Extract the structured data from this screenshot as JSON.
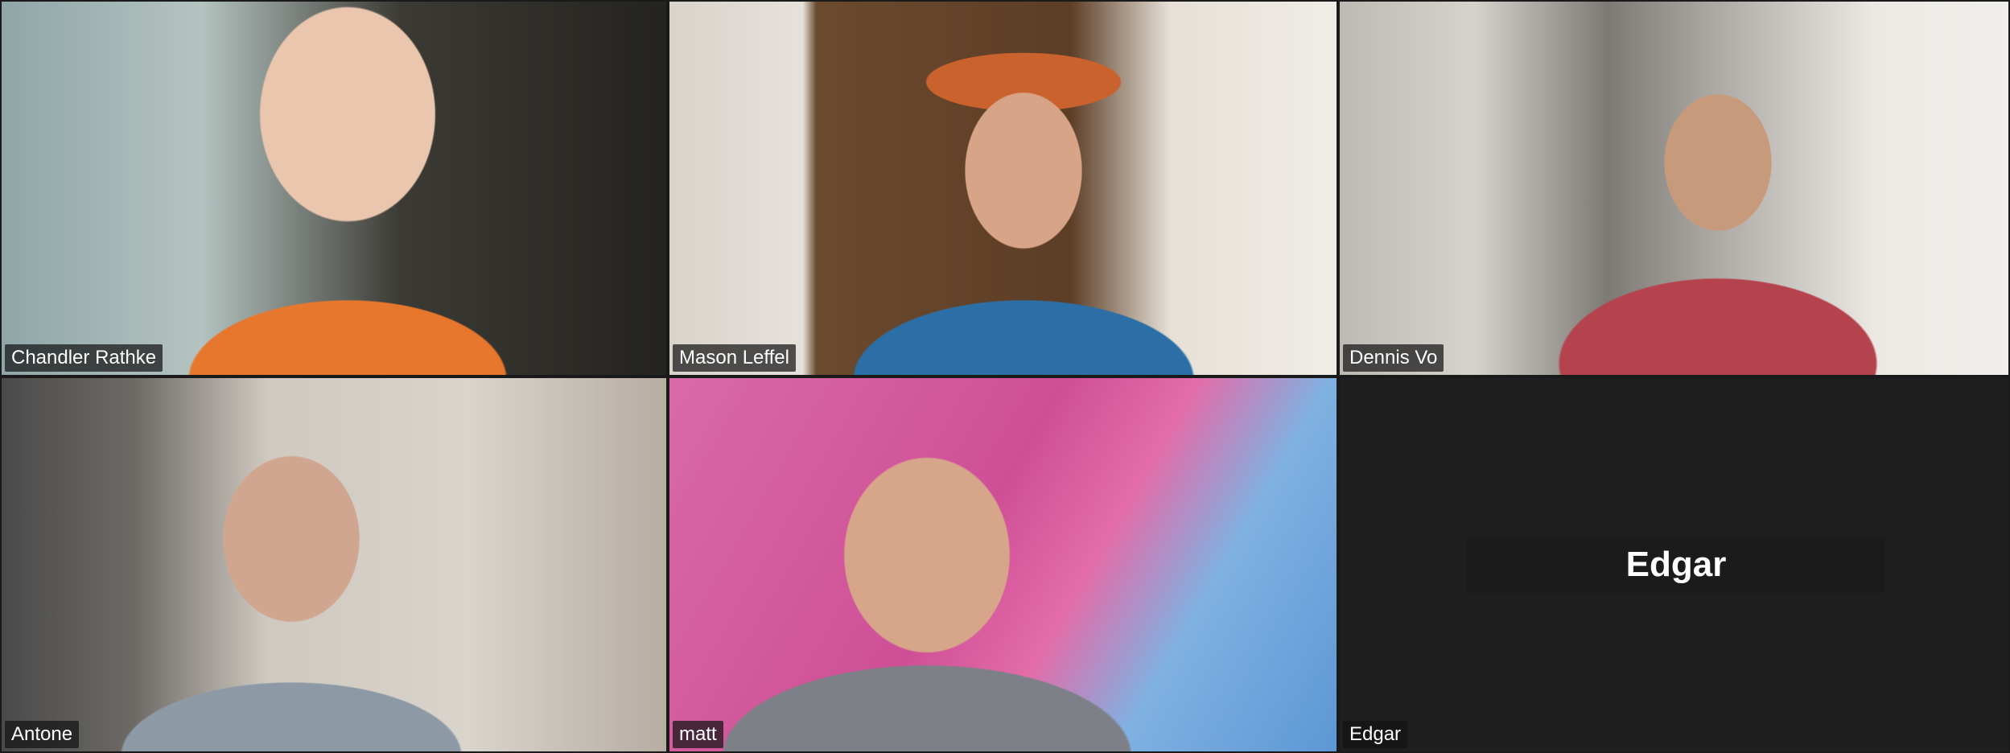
{
  "app": "video conference gallery view",
  "participants": [
    {
      "name": "Chandler Rathke",
      "video": "on"
    },
    {
      "name": "Mason Leffel",
      "video": "on"
    },
    {
      "name": "Dennis Vo",
      "video": "on"
    },
    {
      "name": "Antone",
      "video": "on"
    },
    {
      "name": "matt",
      "video": "on"
    },
    {
      "name": "Edgar",
      "video": "off",
      "display_name": "Edgar"
    }
  ]
}
